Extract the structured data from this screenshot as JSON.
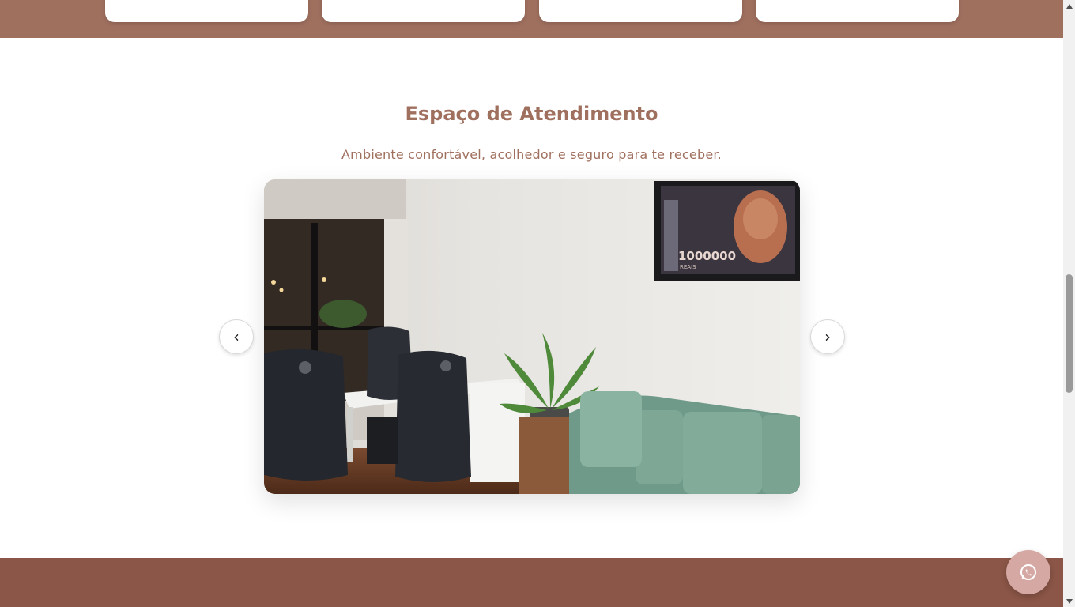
{
  "section": {
    "title": "Espaço de Atendimento",
    "subtitle": "Ambiente confortável, acolhedor e seguro para te receber."
  },
  "carousel": {
    "prev_label": "‹",
    "next_label": "›",
    "slide_description_icon": "office-photo",
    "banknote_text": "1000000",
    "banknote_sub": "REAIS"
  },
  "floating": {
    "whatsapp_icon": "whatsapp-icon"
  },
  "colors": {
    "brand": "#a0705f",
    "footer": "#8b5647",
    "whatsapp_bg": "#d5a8a3"
  }
}
